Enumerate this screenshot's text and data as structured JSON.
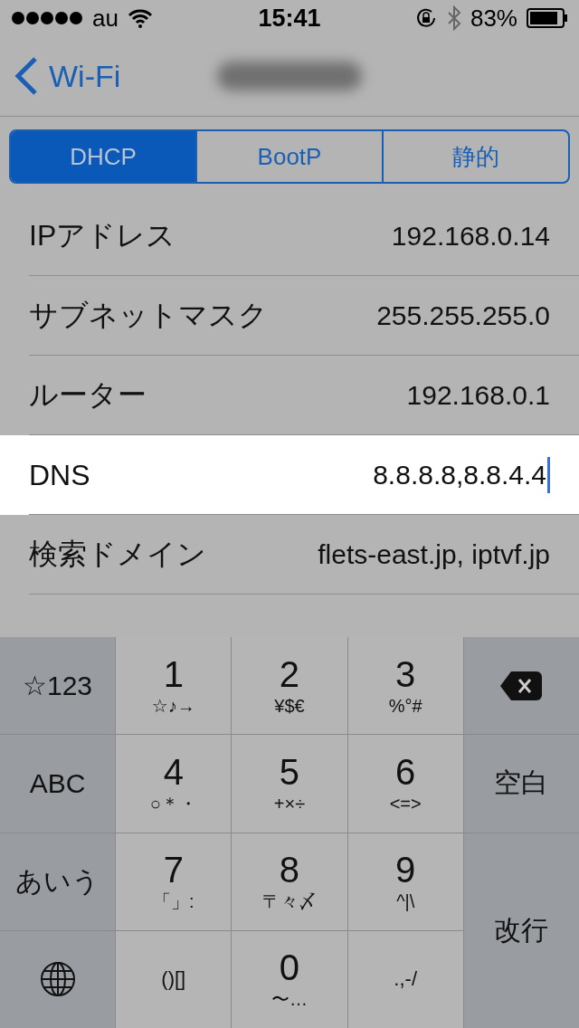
{
  "status_bar": {
    "carrier": "au",
    "time": "15:41",
    "battery": "83%"
  },
  "nav": {
    "back": "Wi-Fi"
  },
  "segments": [
    {
      "label": "DHCP",
      "selected": true
    },
    {
      "label": "BootP",
      "selected": false
    },
    {
      "label": "静的",
      "selected": false
    }
  ],
  "rows": [
    {
      "label": "IPアドレス",
      "value": "192.168.0.14",
      "focused": false
    },
    {
      "label": "サブネットマスク",
      "value": "255.255.255.0",
      "focused": false
    },
    {
      "label": "ルーター",
      "value": "192.168.0.1",
      "focused": false
    },
    {
      "label": "DNS",
      "value": "8.8.8.8,8.8.4.4",
      "focused": true
    },
    {
      "label": "検索ドメイン",
      "value": "flets-east.jp, iptvf.jp",
      "focused": false
    }
  ],
  "keyboard": [
    {
      "kind": "function",
      "label": "☆123"
    },
    {
      "kind": "digit",
      "label": "1",
      "sub": "☆♪→"
    },
    {
      "kind": "digit",
      "label": "2",
      "sub": "¥$€"
    },
    {
      "kind": "digit",
      "label": "3",
      "sub": "%°#"
    },
    {
      "kind": "delete"
    },
    {
      "kind": "function",
      "label": "ABC"
    },
    {
      "kind": "digit",
      "label": "4",
      "sub": "○＊・"
    },
    {
      "kind": "digit",
      "label": "5",
      "sub": "+×÷"
    },
    {
      "kind": "digit",
      "label": "6",
      "sub": "<=>"
    },
    {
      "kind": "function",
      "label": "空白"
    },
    {
      "kind": "function",
      "label": "あいう"
    },
    {
      "kind": "digit",
      "label": "7",
      "sub": "「」:"
    },
    {
      "kind": "digit",
      "label": "8",
      "sub": "〒々〆"
    },
    {
      "kind": "digit",
      "label": "9",
      "sub": "^|\\"
    },
    {
      "kind": "return",
      "label": "改行"
    },
    {
      "kind": "globe"
    },
    {
      "kind": "symbol",
      "label": "()[]"
    },
    {
      "kind": "digit",
      "label": "0",
      "sub": "〜…"
    },
    {
      "kind": "symbol",
      "label": ".,-/"
    }
  ]
}
